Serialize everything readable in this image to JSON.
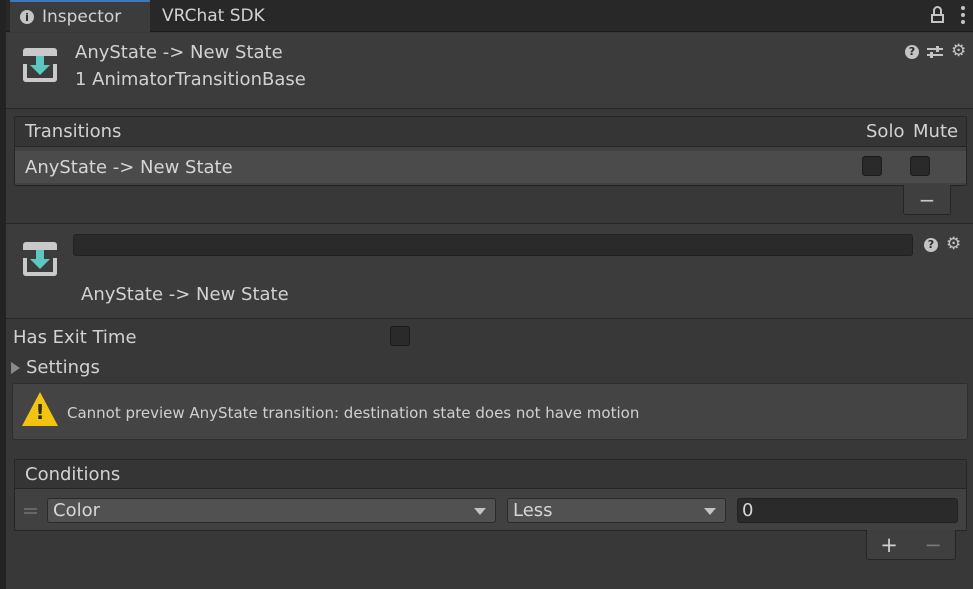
{
  "tabs": [
    {
      "label": "Inspector",
      "icon": "info-icon",
      "active": true
    },
    {
      "label": "VRChat SDK",
      "active": false
    }
  ],
  "header": {
    "title": "AnyState -> New State",
    "subtitle": "1 AnimatorTransitionBase",
    "icon": "transition-icon"
  },
  "transitions": {
    "header": "Transitions",
    "solo_label": "Solo",
    "mute_label": "Mute",
    "rows": [
      {
        "label": "AnyState -> New State",
        "solo": false,
        "mute": false
      }
    ],
    "remove_label": "−"
  },
  "transition": {
    "name_value": "",
    "title": "AnyState -> New State"
  },
  "properties": {
    "has_exit_time_label": "Has Exit Time",
    "has_exit_time": false,
    "settings_label": "Settings"
  },
  "warning": {
    "message": "Cannot preview AnyState transition:  destination state does not have motion",
    "icon": "warning-icon",
    "color": "#f2c40f"
  },
  "conditions": {
    "header": "Conditions",
    "rows": [
      {
        "parameter": "Color",
        "mode": "Less",
        "value": "0"
      }
    ],
    "add_label": "+",
    "remove_label": "−"
  },
  "colors": {
    "accent": "#3a79bb",
    "transition_arrow": "#5cc8c0"
  }
}
